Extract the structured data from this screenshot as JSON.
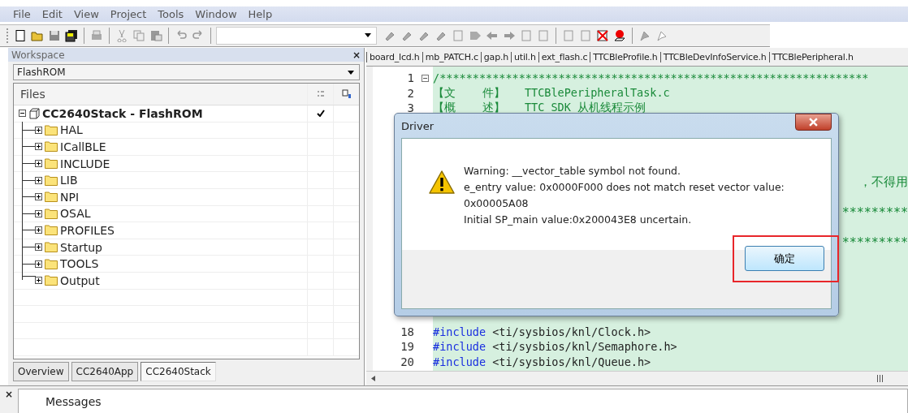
{
  "menu": [
    "File",
    "Edit",
    "View",
    "Project",
    "Tools",
    "Window",
    "Help"
  ],
  "workspace": {
    "title": "Workspace",
    "close": "×",
    "config": "FlashROM",
    "files_header": "Files",
    "tree": {
      "label": "CC2640Stack - FlashROM",
      "expanded": true,
      "checked": true,
      "children": [
        {
          "label": "HAL",
          "expanded": false
        },
        {
          "label": "ICallBLE",
          "expanded": false
        },
        {
          "label": "INCLUDE",
          "expanded": false
        },
        {
          "label": "LIB",
          "expanded": false
        },
        {
          "label": "NPI",
          "expanded": false
        },
        {
          "label": "OSAL",
          "expanded": false
        },
        {
          "label": "PROFILES",
          "expanded": false
        },
        {
          "label": "Startup",
          "expanded": false
        },
        {
          "label": "TOOLS",
          "expanded": false
        },
        {
          "label": "Output",
          "expanded": false
        }
      ]
    },
    "tabs": [
      {
        "label": "Overview",
        "selected": false
      },
      {
        "label": "CC2640App",
        "selected": false
      },
      {
        "label": "CC2640Stack",
        "selected": true
      }
    ]
  },
  "editor": {
    "tabs": [
      "board_lcd.h",
      "mb_PATCH.c",
      "gap.h",
      "util.h",
      "ext_flash.c",
      "TTCBleProfile.h",
      "TTCBleDevInfoService.h",
      "TTCBlePeripheral.h"
    ],
    "top_lines": [
      {
        "number": "1",
        "fold": true,
        "parts": [
          {
            "kind": "comment",
            "text": "/*****************************************************************"
          }
        ]
      },
      {
        "number": "2",
        "parts": [
          {
            "kind": "comment",
            "text": "【文    件】   TTCBlePeripheralTask.c"
          }
        ]
      },
      {
        "number": "3",
        "parts": [
          {
            "kind": "comment",
            "text": "【概    述】   TTC SDK 从机线程示例"
          }
        ]
      }
    ],
    "fragments": [
      "，不得用",
      "*********",
      "*********"
    ],
    "bottom_lines": [
      {
        "number": "18",
        "parts": [
          {
            "kind": "keyword",
            "text": "#include"
          },
          {
            "kind": "plain",
            "text": " <ti/sysbios/knl/Clock.h>"
          }
        ]
      },
      {
        "number": "19",
        "parts": [
          {
            "kind": "keyword",
            "text": "#include"
          },
          {
            "kind": "plain",
            "text": " <ti/sysbios/knl/Semaphore.h>"
          }
        ]
      },
      {
        "number": "20",
        "parts": [
          {
            "kind": "keyword",
            "text": "#include"
          },
          {
            "kind": "plain",
            "text": " <ti/sysbios/knl/Queue.h>"
          }
        ]
      }
    ]
  },
  "dialog": {
    "title": "Driver",
    "message": [
      "Warning:  __vector_table symbol not found.",
      "e_entry value: 0x0000F000 does not match reset vector value:",
      "0x00005A08",
      "Initial SP_main value:0x200043E8 uncertain."
    ],
    "button": "确定",
    "highlighted": true
  },
  "messages": {
    "close": "×",
    "title": "Messages"
  }
}
